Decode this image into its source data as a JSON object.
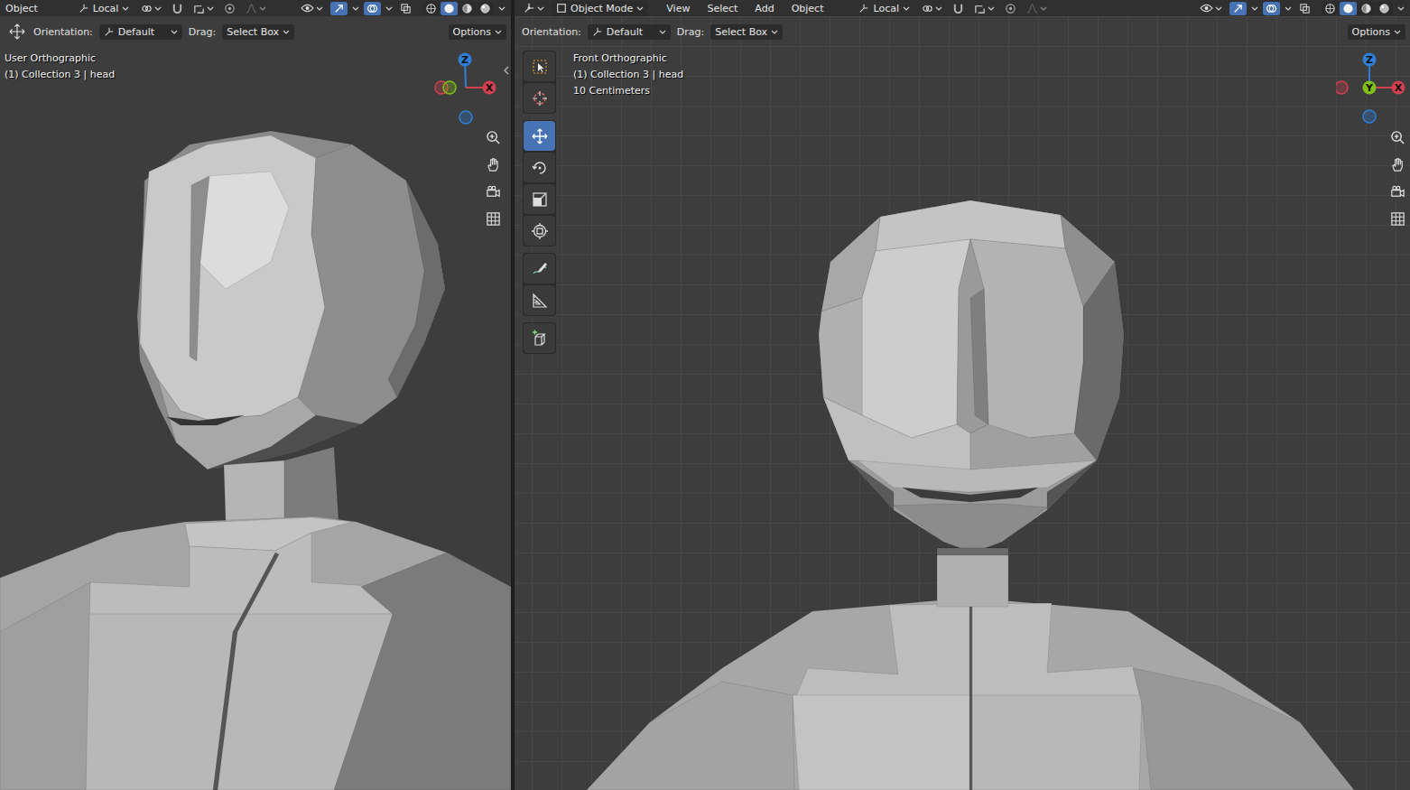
{
  "left_viewport": {
    "header": {
      "scrolled": true,
      "mode": "Object",
      "menus": [],
      "orientation": "Local",
      "snap_on": false,
      "proportional_on": false,
      "gizmos_on": true,
      "overlays_on": true,
      "xray_on": false,
      "shading": [
        {
          "mode": "wireframe",
          "selected": false
        },
        {
          "mode": "solid",
          "selected": true
        },
        {
          "mode": "material",
          "selected": false
        },
        {
          "mode": "rendered",
          "selected": false
        }
      ]
    },
    "tool_settings": {
      "show_tool_icon": true,
      "orientation_label": "Orientation:",
      "orientation": "Default",
      "drag_label": "Drag:",
      "drag": "Select Box",
      "options": "Options"
    },
    "overlay_text": [
      "User Orthographic",
      "(1) Collection 3 | head"
    ],
    "gizmo": [
      {
        "axis": "-x",
        "label": "",
        "color": "#d0404f"
      },
      {
        "axis": "-z",
        "label": "",
        "color": "#2f7fd6"
      },
      {
        "axis": "-y",
        "label": "",
        "color": "#7fbf1a"
      },
      {
        "axis": "+z",
        "label": "Z",
        "color": "#2f7fd6"
      },
      {
        "axis": "+x",
        "label": "X",
        "color": "#d0404f"
      }
    ],
    "toolbar": [],
    "grid": false
  },
  "right_viewport": {
    "header": {
      "scrolled": false,
      "mode": "Object Mode",
      "menus": [
        "View",
        "Select",
        "Add",
        "Object"
      ],
      "orientation": "Local",
      "snap_on": false,
      "proportional_on": false,
      "gizmos_on": true,
      "overlays_on": true,
      "xray_on": false,
      "shading": [
        {
          "mode": "wireframe",
          "selected": false
        },
        {
          "mode": "solid",
          "selected": true
        },
        {
          "mode": "material",
          "selected": false
        },
        {
          "mode": "rendered",
          "selected": false
        }
      ]
    },
    "tool_settings": {
      "show_tool_icon": false,
      "orientation_label": "Orientation:",
      "orientation": "Default",
      "drag_label": "Drag:",
      "drag": "Select Box",
      "options": "Options"
    },
    "overlay_text": [
      "Front Orthographic",
      "(1) Collection 3 | head",
      "10 Centimeters"
    ],
    "gizmo": [
      {
        "axis": "-x",
        "label": "",
        "color": "#d0404f"
      },
      {
        "axis": "-z",
        "label": "",
        "color": "#2f7fd6"
      },
      {
        "axis": "+z",
        "label": "Z",
        "color": "#2f7fd6"
      },
      {
        "axis": "+x",
        "label": "X",
        "color": "#d0404f"
      },
      {
        "axis": "+y",
        "label": "Y",
        "color": "#7fbf1a"
      }
    ],
    "toolbar": [
      [
        {
          "kind": "select-box",
          "selected": false
        },
        {
          "kind": "cursor",
          "selected": false
        }
      ],
      [
        {
          "kind": "move",
          "selected": true
        },
        {
          "kind": "rotate",
          "selected": false
        },
        {
          "kind": "scale",
          "selected": false
        },
        {
          "kind": "transform",
          "selected": false
        }
      ],
      [
        {
          "kind": "annotate",
          "selected": false
        },
        {
          "kind": "measure",
          "selected": false
        }
      ],
      [
        {
          "kind": "add-cube",
          "selected": false
        }
      ]
    ],
    "grid": true
  }
}
